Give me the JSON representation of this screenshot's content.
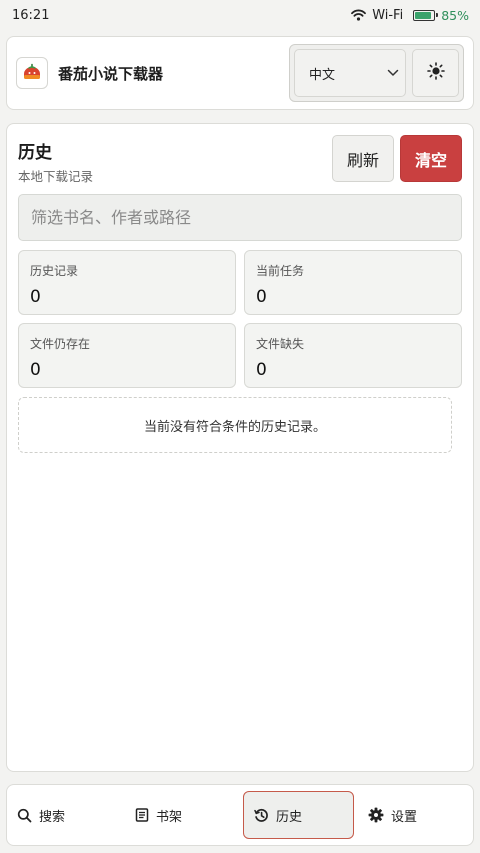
{
  "status_bar": {
    "time": "16:21",
    "network": "Wi-Fi",
    "battery_text": "85%",
    "battery_level": 0.85,
    "battery_color": "#3aa26b"
  },
  "header": {
    "app_title": "番茄小说下载器",
    "language_value": "中文",
    "logo_icon": "tomato-icon",
    "theme_icon": "sun-icon"
  },
  "history": {
    "title": "历史",
    "subtitle": "本地下载记录",
    "refresh_label": "刷新",
    "clear_label": "清空",
    "filter_placeholder": "筛选书名、作者或路径",
    "filter_value": "",
    "stats": [
      {
        "label": "历史记录",
        "value": "0"
      },
      {
        "label": "当前任务",
        "value": "0"
      },
      {
        "label": "文件仍存在",
        "value": "0"
      },
      {
        "label": "文件缺失",
        "value": "0"
      }
    ],
    "empty_message": "当前没有符合条件的历史记录。"
  },
  "nav": {
    "items": [
      {
        "label": "搜索",
        "icon": "search-icon"
      },
      {
        "label": "书架",
        "icon": "bookshelf-icon"
      },
      {
        "label": "历史",
        "icon": "history-icon"
      },
      {
        "label": "设置",
        "icon": "gear-icon"
      }
    ],
    "active": "历史"
  },
  "colors": {
    "accent_danger": "#c94040",
    "active_border": "#c55a4a",
    "logo_red": "#d9432f",
    "logo_orange": "#f08a24"
  }
}
